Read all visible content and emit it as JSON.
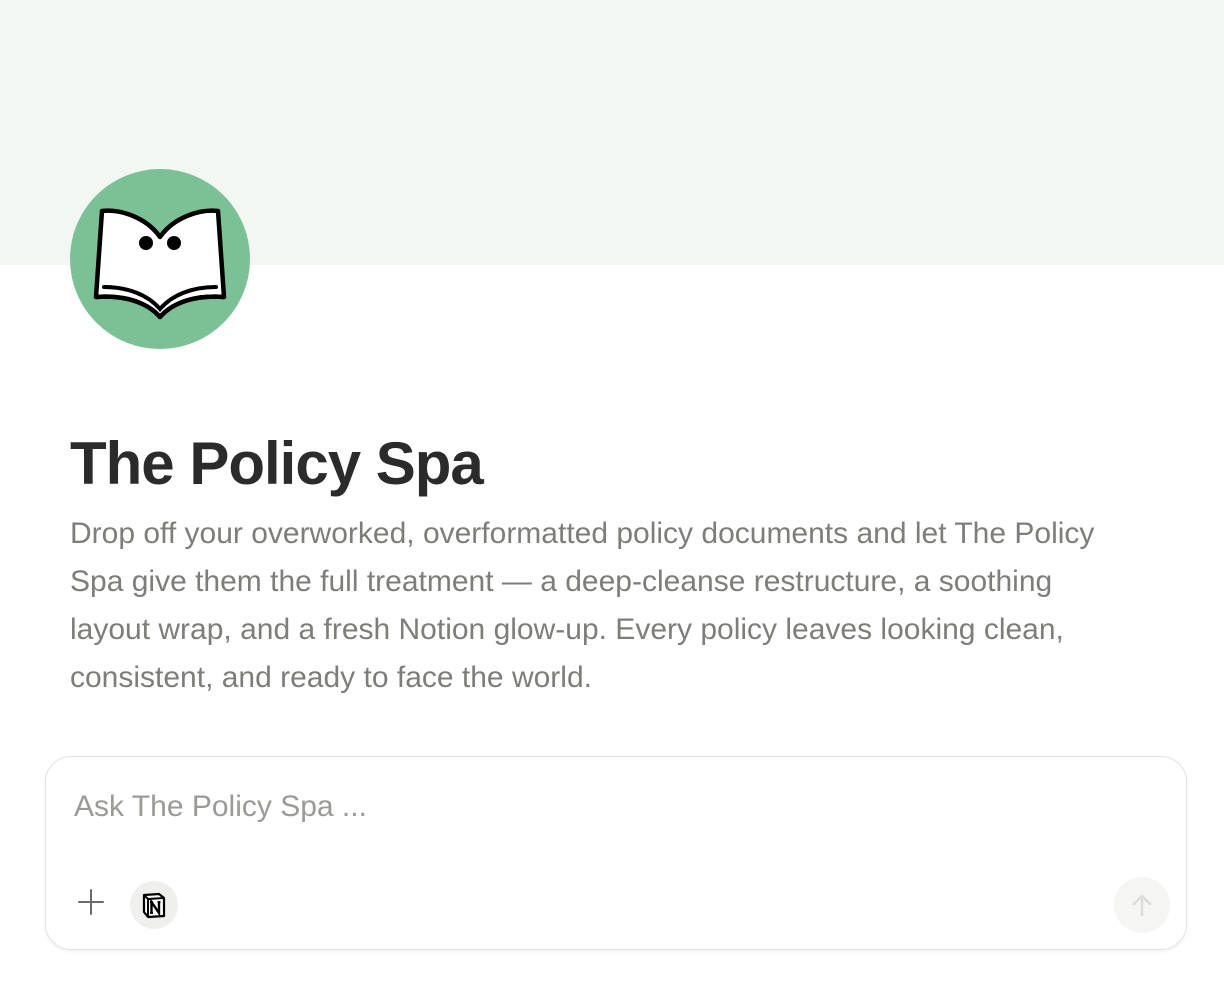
{
  "page": {
    "title": "The Policy Spa",
    "description": "Drop off your overworked, overformatted policy documents and let The Policy Spa give them the full treatment — a deep-cleanse restructure, a soothing layout wrap, and a fresh Notion glow-up. Every policy leaves looking clean, consistent, and ready to face the world.",
    "avatar_icon": "open-book-face-icon",
    "colors": {
      "cover": "#f2f7f4",
      "avatar_background": "#7cc196",
      "title": "#2b2b2b",
      "description": "#7d7d7a"
    }
  },
  "composer": {
    "placeholder": "Ask The Policy Spa ...",
    "value": "",
    "add_icon": "plus-icon",
    "source_icon": "notion-logo-icon",
    "send_icon": "arrow-up-icon",
    "send_enabled": false
  }
}
